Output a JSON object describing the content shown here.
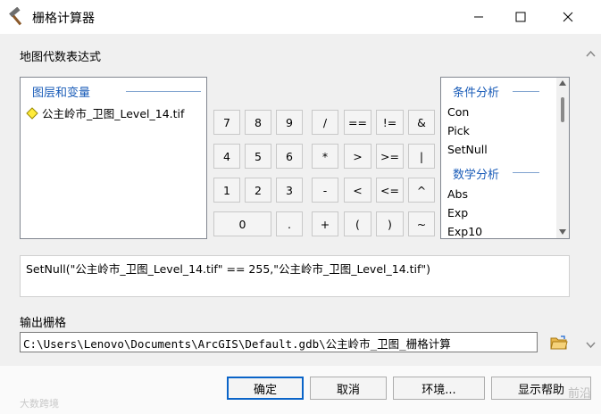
{
  "window": {
    "title": "栅格计算器"
  },
  "labels": {
    "map_algebra": "地图代数表达式",
    "layers_header": "图层和变量",
    "output_raster": "输出栅格"
  },
  "layers": [
    {
      "name": "公主岭市_卫图_Level_14.tif"
    }
  ],
  "keypad": {
    "digits": [
      "7",
      "8",
      "9",
      "4",
      "5",
      "6",
      "1",
      "2",
      "3",
      "0",
      "."
    ],
    "operators": [
      "/",
      "==",
      "!=",
      "&",
      "*",
      ">",
      ">=",
      "|",
      "-",
      "<",
      "<=",
      "^",
      "+",
      "(",
      ")",
      "~"
    ]
  },
  "functions": {
    "group1": "条件分析",
    "group1_items": [
      "Con",
      "Pick",
      "SetNull"
    ],
    "group2": "数学分析",
    "group2_items": [
      "Abs",
      "Exp",
      "Exp10"
    ]
  },
  "expression": "SetNull(\"公主岭市_卫图_Level_14.tif\" == 255,\"公主岭市_卫图_Level_14.tif\")",
  "output_path": "C:\\Users\\Lenovo\\Documents\\ArcGIS\\Default.gdb\\公主岭市_卫图_栅格计算",
  "buttons": {
    "ok": "确定",
    "cancel": "取消",
    "env": "环境...",
    "help": "显示帮助"
  },
  "watermarks": {
    "left": "大数跨境",
    "right": "前沿"
  }
}
